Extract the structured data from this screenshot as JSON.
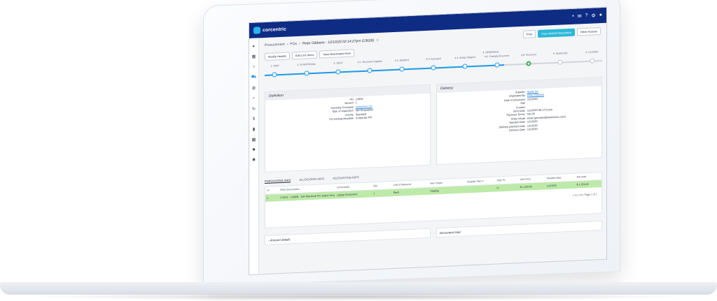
{
  "app": {
    "logo_text": "corcentric"
  },
  "breadcrumb": {
    "root": "Procurement",
    "section": "POs",
    "current": "Peter Gibbons - 12/10/20 02:14:27pm (13628)"
  },
  "actions": {
    "print": "Print",
    "related": "View related Requisition",
    "other": "Other Actions"
  },
  "toolbar": {
    "modify": "Modify Header",
    "edit": "Edit Line Items",
    "view": "View deactivated lines"
  },
  "steps": [
    {
      "label": "1. NEW"
    },
    {
      "label": "2. IN APPROVAL"
    },
    {
      "label": "3. SENT"
    },
    {
      "label": "4-1. Received Supplier"
    },
    {
      "label": "4-2. Modified"
    },
    {
      "label": "4-3. Activated"
    },
    {
      "label": "4-4. Being Shipped"
    },
    {
      "label": "4-5. Partially Received"
    },
    {
      "label": "4-6. Received"
    },
    {
      "label": "5. INVOICED"
    },
    {
      "label": "6. CLOSED"
    }
  ],
  "steps_stage": "4. ORDERING",
  "definition": {
    "title": "Definition",
    "rows": [
      {
        "k": "PO",
        "v": "13628"
      },
      {
        "k": "Version",
        "v": "1"
      },
      {
        "k": "Invoicing Company",
        "v": "Determine US"
      },
      {
        "k": "Type of requisition",
        "v": "Std Requisition"
      },
      {
        "k": "Priority",
        "v": "Standard"
      },
      {
        "k": "PO printing template",
        "v": "Corporate PO"
      }
    ]
  },
  "delivery": {
    "title": "Delivery",
    "rows": [
      {
        "k": "Supplier",
        "v": "Apple Inc"
      },
      {
        "k": "Originated By",
        "v": "Peter Gibbons"
      },
      {
        "k": "Date of document",
        "v": "12/10/20"
      },
      {
        "k": "Site",
        "v": ""
      },
      {
        "k": "Contact",
        "v": ""
      },
      {
        "k": "Sent Date",
        "v": "12/10/20 06:17:21am"
      },
      {
        "k": "Payment Terms",
        "v": "Net 30"
      },
      {
        "k": "Order Mode",
        "v": "email (jbreales@determine.com)"
      },
      {
        "k": "Needed Date",
        "v": "12/15/20"
      },
      {
        "k": "Delivery planned Date",
        "v": "12/15/20"
      },
      {
        "k": "Delivery Date",
        "v": "12/10/20"
      }
    ]
  },
  "tabs": [
    "PURCHASING INFO",
    "ALLOCATION INFO",
    "ACCOUNTING INFO"
  ],
  "grid": {
    "headers": [
      "N°",
      "Short Description",
      "Commodity",
      "Qty",
      "Unit of Measure",
      "Item Origin",
      "Supplier Part #",
      "Ship To",
      "Unit Price",
      "Needed date",
      "Net total"
    ],
    "row": [
      "1",
      "2.3Ghz - 128GB - 13in Macbook Pro Space Grey",
      "Laptop Computers",
      "1",
      "Each",
      "Catalog",
      "",
      "IT",
      "$ 1,259.00",
      "12/15/20",
      "$ 1,259.00"
    ],
    "pager": "1 to 1 of 1   Page 1 of 1"
  },
  "footer": {
    "left": "Amount details",
    "right": "Document total"
  }
}
